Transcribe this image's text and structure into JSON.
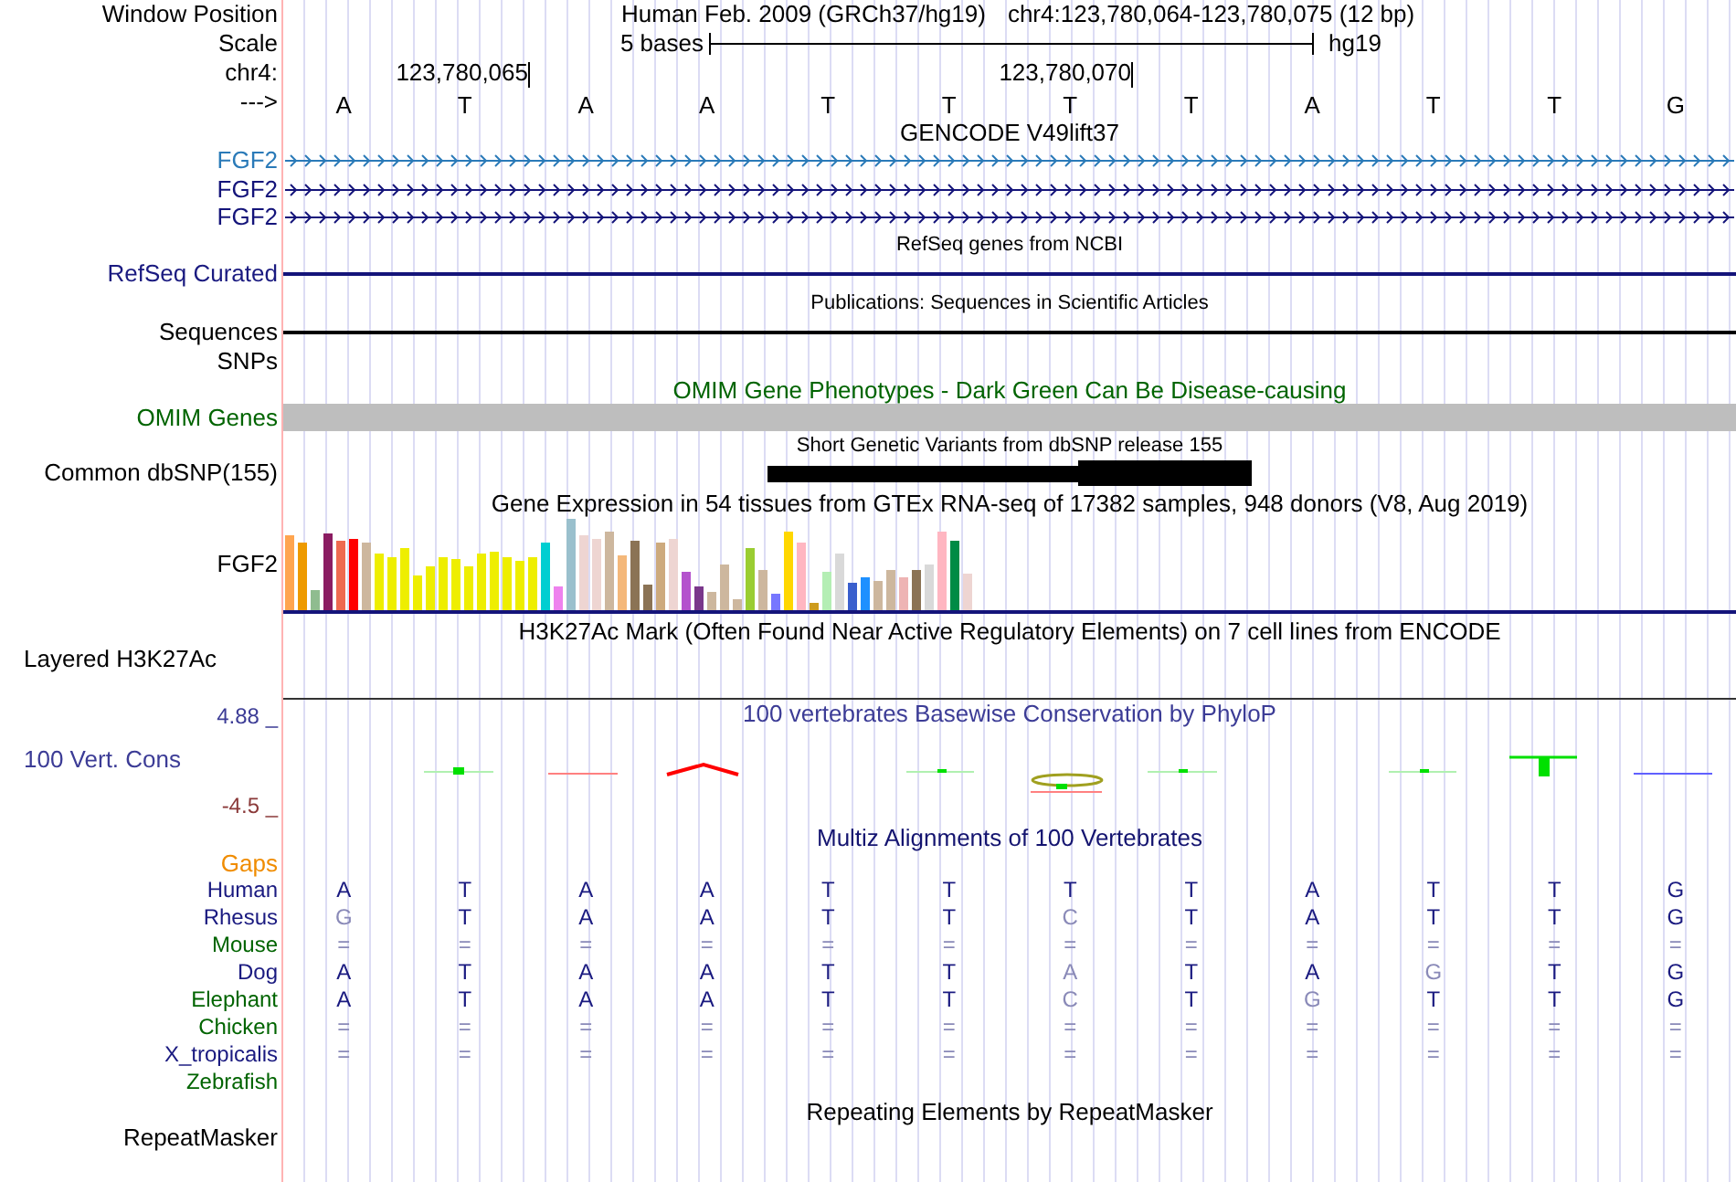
{
  "ruler": {
    "position_label": "Window Position",
    "assembly": "Human Feb. 2009 (GRCh37/hg19)",
    "position": "chr4:123,780,064-123,780,075 (12 bp)",
    "scale_label": "Scale",
    "scale_text": "5 bases",
    "scale_db": "hg19",
    "chrom_label": "chr4:",
    "ticks": [
      "123,780,065",
      "123,780,070"
    ],
    "strand_label": "--->",
    "bases": [
      "A",
      "T",
      "A",
      "A",
      "T",
      "T",
      "T",
      "T",
      "A",
      "T",
      "T",
      "G"
    ]
  },
  "gencode": {
    "title": "GENCODE V49lift37",
    "genes": [
      {
        "name": "FGF2",
        "color": "#2a7ab8"
      },
      {
        "name": "FGF2",
        "color": "#14147a"
      },
      {
        "name": "FGF2",
        "color": "#14147a"
      }
    ]
  },
  "refseq": {
    "title": "RefSeq genes from NCBI",
    "label": "RefSeq Curated"
  },
  "publications": {
    "title": "Publications: Sequences in Scientific Articles",
    "label": "Sequences"
  },
  "snps_label": "SNPs",
  "omim": {
    "title": "OMIM Gene Phenotypes - Dark Green Can Be Disease-causing",
    "label": "OMIM Genes"
  },
  "dbsnp": {
    "title": "Short Genetic Variants from dbSNP release 155",
    "label": "Common dbSNP(155)"
  },
  "gtex": {
    "title": "Gene Expression in 54 tissues from GTEx RNA-seq of 17382 samples, 948 donors (V8, Aug 2019)",
    "label": "FGF2"
  },
  "h3k27ac": {
    "title": "H3K27Ac Mark (Often Found Near Active Regulatory Elements) on 7 cell lines from ENCODE",
    "label": "Layered H3K27Ac"
  },
  "conservation": {
    "title": "100 vertebrates Basewise Conservation by PhyloP",
    "label": "100 Vert. Cons",
    "max": "4.88 _",
    "min": "-4.5 _"
  },
  "multiz": {
    "title": "Multiz Alignments of 100 Vertebrates",
    "gaps_label": "Gaps",
    "species": [
      {
        "name": "Human",
        "color": "#1a1a80",
        "cells": [
          {
            "base": "A",
            "faded": false
          },
          {
            "base": "T",
            "faded": false
          },
          {
            "base": "A",
            "faded": false
          },
          {
            "base": "A",
            "faded": false
          },
          {
            "base": "T",
            "faded": false
          },
          {
            "base": "T",
            "faded": false
          },
          {
            "base": "T",
            "faded": false
          },
          {
            "base": "T",
            "faded": false
          },
          {
            "base": "A",
            "faded": false
          },
          {
            "base": "T",
            "faded": false
          },
          {
            "base": "T",
            "faded": false
          },
          {
            "base": "G",
            "faded": false
          }
        ]
      },
      {
        "name": "Rhesus",
        "color": "#1a1a80",
        "cells": [
          {
            "base": "G",
            "faded": true
          },
          {
            "base": "T",
            "faded": false
          },
          {
            "base": "A",
            "faded": false
          },
          {
            "base": "A",
            "faded": false
          },
          {
            "base": "T",
            "faded": false
          },
          {
            "base": "T",
            "faded": false
          },
          {
            "base": "C",
            "faded": true
          },
          {
            "base": "T",
            "faded": false
          },
          {
            "base": "A",
            "faded": false
          },
          {
            "base": "T",
            "faded": false
          },
          {
            "base": "T",
            "faded": false
          },
          {
            "base": "G",
            "faded": false
          }
        ]
      },
      {
        "name": "Mouse",
        "color": "#006400",
        "cells": [
          {
            "base": "=",
            "faded": true
          },
          {
            "base": "=",
            "faded": true
          },
          {
            "base": "=",
            "faded": true
          },
          {
            "base": "=",
            "faded": true
          },
          {
            "base": "=",
            "faded": true
          },
          {
            "base": "=",
            "faded": true
          },
          {
            "base": "=",
            "faded": true
          },
          {
            "base": "=",
            "faded": true
          },
          {
            "base": "=",
            "faded": true
          },
          {
            "base": "=",
            "faded": true
          },
          {
            "base": "=",
            "faded": true
          },
          {
            "base": "=",
            "faded": true
          }
        ]
      },
      {
        "name": "Dog",
        "color": "#1a1a80",
        "cells": [
          {
            "base": "A",
            "faded": false
          },
          {
            "base": "T",
            "faded": false
          },
          {
            "base": "A",
            "faded": false
          },
          {
            "base": "A",
            "faded": false
          },
          {
            "base": "T",
            "faded": false
          },
          {
            "base": "T",
            "faded": false
          },
          {
            "base": "A",
            "faded": true
          },
          {
            "base": "T",
            "faded": false
          },
          {
            "base": "A",
            "faded": false
          },
          {
            "base": "G",
            "faded": true
          },
          {
            "base": "T",
            "faded": false
          },
          {
            "base": "G",
            "faded": false
          }
        ]
      },
      {
        "name": "Elephant",
        "color": "#006400",
        "cells": [
          {
            "base": "A",
            "faded": false
          },
          {
            "base": "T",
            "faded": false
          },
          {
            "base": "A",
            "faded": false
          },
          {
            "base": "A",
            "faded": false
          },
          {
            "base": "T",
            "faded": false
          },
          {
            "base": "T",
            "faded": false
          },
          {
            "base": "C",
            "faded": true
          },
          {
            "base": "T",
            "faded": false
          },
          {
            "base": "G",
            "faded": true
          },
          {
            "base": "T",
            "faded": false
          },
          {
            "base": "T",
            "faded": false
          },
          {
            "base": "G",
            "faded": false
          }
        ]
      },
      {
        "name": "Chicken",
        "color": "#006400",
        "cells": [
          {
            "base": "=",
            "faded": true
          },
          {
            "base": "=",
            "faded": true
          },
          {
            "base": "=",
            "faded": true
          },
          {
            "base": "=",
            "faded": true
          },
          {
            "base": "=",
            "faded": true
          },
          {
            "base": "=",
            "faded": true
          },
          {
            "base": "=",
            "faded": true
          },
          {
            "base": "=",
            "faded": true
          },
          {
            "base": "=",
            "faded": true
          },
          {
            "base": "=",
            "faded": true
          },
          {
            "base": "=",
            "faded": true
          },
          {
            "base": "=",
            "faded": true
          }
        ]
      },
      {
        "name": "X_tropicalis",
        "color": "#1a1a80",
        "cells": [
          {
            "base": "=",
            "faded": true
          },
          {
            "base": "=",
            "faded": true
          },
          {
            "base": "=",
            "faded": true
          },
          {
            "base": "=",
            "faded": true
          },
          {
            "base": "=",
            "faded": true
          },
          {
            "base": "=",
            "faded": true
          },
          {
            "base": "=",
            "faded": true
          },
          {
            "base": "=",
            "faded": true
          },
          {
            "base": "=",
            "faded": true
          },
          {
            "base": "=",
            "faded": true
          },
          {
            "base": "=",
            "faded": true
          },
          {
            "base": "=",
            "faded": true
          }
        ]
      },
      {
        "name": "Zebrafish",
        "color": "#006400"
      }
    ]
  },
  "repeatmasker": {
    "title": "Repeating Elements by RepeatMasker",
    "label": "RepeatMasker"
  }
}
